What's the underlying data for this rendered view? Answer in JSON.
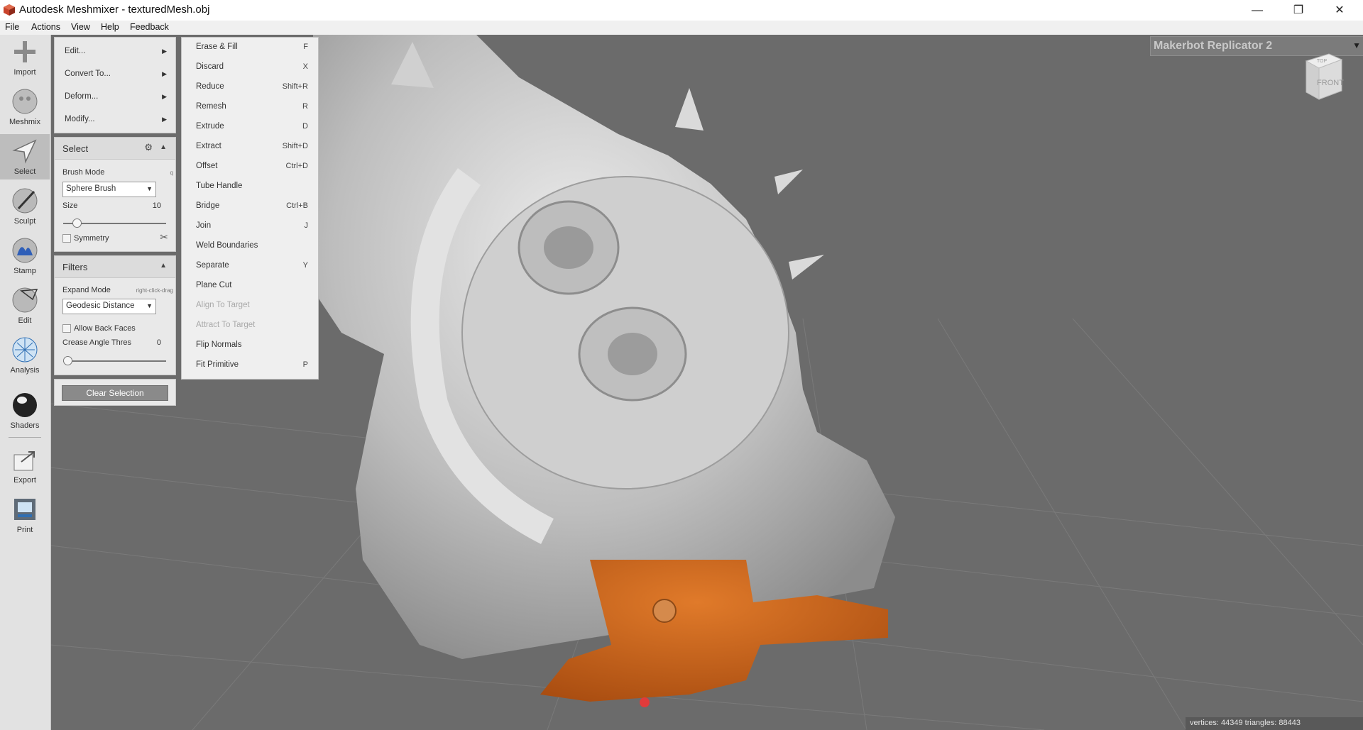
{
  "window": {
    "title": "Autodesk Meshmixer - texturedMesh.obj",
    "minimize": "—",
    "maximize": "❐",
    "close": "✕"
  },
  "menu": [
    "File",
    "Actions",
    "View",
    "Help",
    "Feedback"
  ],
  "tools": [
    "Import",
    "Meshmix",
    "Select",
    "Sculpt",
    "Stamp",
    "Edit",
    "Analysis",
    "Shaders",
    "Export",
    "Print"
  ],
  "edit_menu": [
    "Edit...",
    "Convert To...",
    "Deform...",
    "Modify..."
  ],
  "select_panel": {
    "title": "Select",
    "brush_mode_label": "Brush Mode",
    "brush_mode_hint": "q",
    "brush_mode_value": "Sphere Brush",
    "size_label": "Size",
    "size_value": "10",
    "size_level": 0.1,
    "symmetry_label": "Symmetry"
  },
  "filters_panel": {
    "title": "Filters",
    "expand_mode_label": "Expand Mode",
    "expand_mode_hint": "right-click-drag",
    "expand_mode_value": "Geodesic Distance",
    "allow_back_faces_label": "Allow Back Faces",
    "crease_label": "Crease Angle Thres",
    "crease_value": "0",
    "crease_level": 0
  },
  "clear_selection": "Clear Selection",
  "submenu": [
    {
      "label": "Erase & Fill",
      "shortcut": "F"
    },
    {
      "label": "Discard",
      "shortcut": "X"
    },
    {
      "label": "Reduce",
      "shortcut": "Shift+R"
    },
    {
      "label": "Remesh",
      "shortcut": "R"
    },
    {
      "label": "Extrude",
      "shortcut": "D"
    },
    {
      "label": "Extract",
      "shortcut": "Shift+D"
    },
    {
      "label": "Offset",
      "shortcut": "Ctrl+D"
    },
    {
      "label": "Tube Handle",
      "shortcut": ""
    },
    {
      "label": "Bridge",
      "shortcut": "Ctrl+B"
    },
    {
      "label": "Join",
      "shortcut": "J"
    },
    {
      "label": "Weld Boundaries",
      "shortcut": ""
    },
    {
      "label": "Separate",
      "shortcut": "Y"
    },
    {
      "label": "Plane Cut",
      "shortcut": ""
    },
    {
      "label": "Align To Target",
      "shortcut": ""
    },
    {
      "label": "Attract To Target",
      "shortcut": ""
    },
    {
      "label": "Flip Normals",
      "shortcut": ""
    },
    {
      "label": "Fit Primitive",
      "shortcut": "P"
    }
  ],
  "printer": "Makerbot Replicator 2",
  "view_cube": {
    "top": "TOP",
    "front": "FRONT"
  },
  "status": "vertices: 44349 triangles: 88443",
  "colors": {
    "selection": "#c8651a",
    "viewport": "#6b6b6b",
    "panel": "#e9e9e9"
  }
}
